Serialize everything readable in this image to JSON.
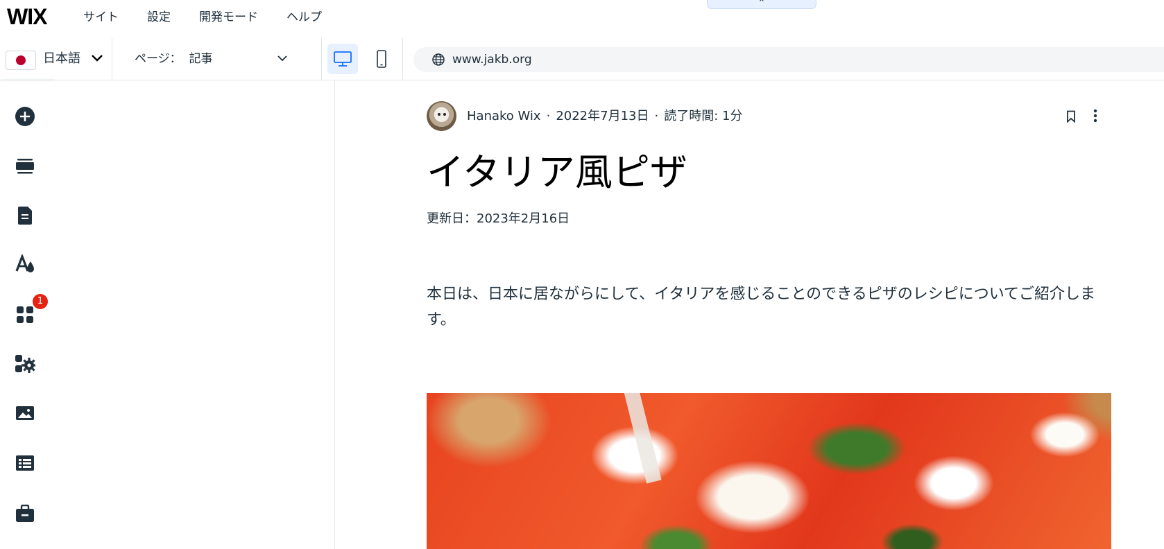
{
  "topbar": {
    "logo": "WIX",
    "menu": [
      "サイト",
      "設定",
      "開発モード",
      "ヘルプ"
    ],
    "collapse_glyph": "⌃"
  },
  "toolbar": {
    "language": "日本語",
    "page_label": "ページ：  記事",
    "url": "www.jakb.org",
    "device_selected": "desktop"
  },
  "sidebar": {
    "items": [
      {
        "icon": "add-icon"
      },
      {
        "icon": "sections-icon"
      },
      {
        "icon": "pages-icon"
      },
      {
        "icon": "design-icon"
      },
      {
        "icon": "apps-icon",
        "badge": "1"
      },
      {
        "icon": "business-apps-icon"
      },
      {
        "icon": "media-icon"
      },
      {
        "icon": "cms-icon"
      },
      {
        "icon": "portfolio-icon"
      }
    ]
  },
  "post": {
    "author": "Hanako Wix",
    "date": "2022年7月13日",
    "read_time": "読了時間: 1分",
    "separator": "·",
    "title": "イタリア風ピザ",
    "updated": "更新日：2023年2月16日",
    "body": "本日は、日本に居ながらにして、イタリアを感じることのできるピザのレシピについてご紹介します。"
  },
  "colors": {
    "accent": "#116dff",
    "badge": "#e62214",
    "selected_device_bg": "#e7f0ff"
  }
}
